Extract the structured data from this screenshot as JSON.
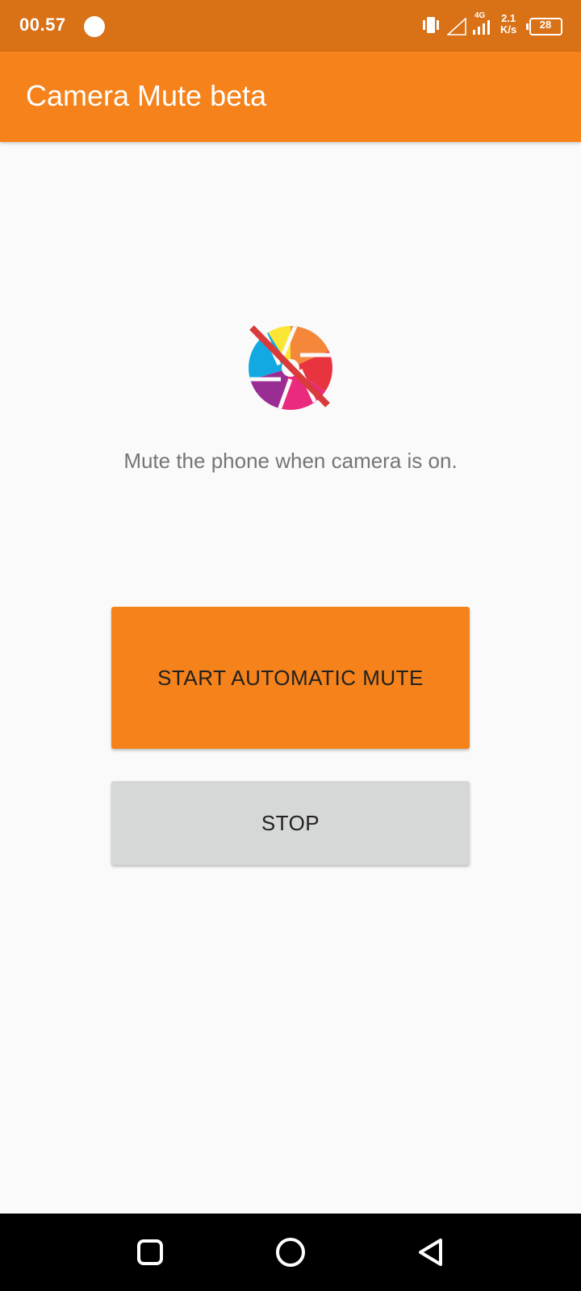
{
  "status_bar": {
    "time": "00.57",
    "network_type": "4G",
    "speed_value": "2.1",
    "speed_unit": "K/s",
    "battery": "28",
    "icons": [
      "notification-dot",
      "vibrate-icon",
      "signal-empty-icon",
      "signal-4g-icon",
      "battery-icon"
    ]
  },
  "app_bar": {
    "title": "Camera Mute beta"
  },
  "main": {
    "logo_icon": "camera-muted-icon",
    "description": "Mute the phone when camera is on.",
    "start_button_label": "START AUTOMATIC MUTE",
    "stop_button_label": "STOP"
  },
  "colors": {
    "status_bar": "#d97116",
    "primary": "#f5821a",
    "stop_button": "#d6d7d7",
    "background": "#fafafa",
    "description_text": "#757575"
  },
  "nav_bar": {
    "icons": [
      "recents-icon",
      "home-icon",
      "back-icon"
    ]
  }
}
